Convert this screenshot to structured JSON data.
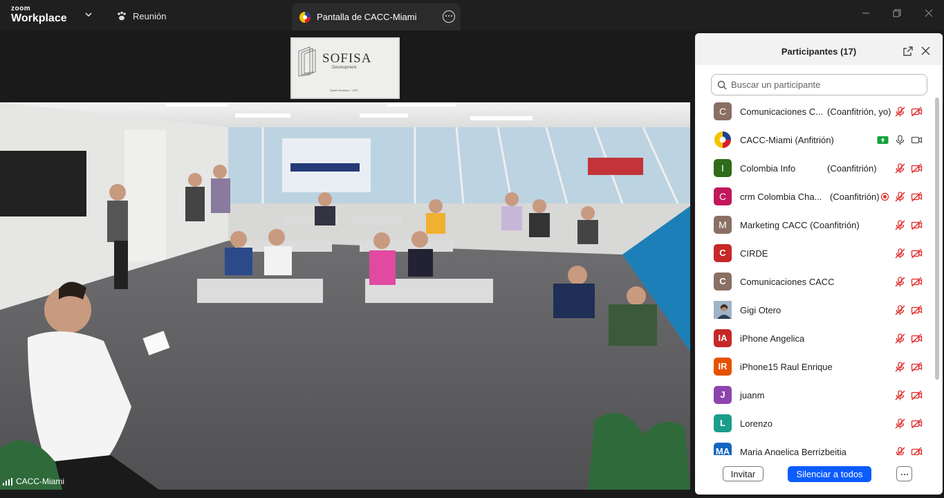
{
  "app": {
    "brand_top": "zoom",
    "brand_bottom": "Workplace"
  },
  "tabs": {
    "meeting_label": "Reunión",
    "share_label": "Pantalla de CACC-Miami"
  },
  "slide": {
    "title": "SOFISA",
    "subtitle": "Development",
    "footer": "Daniel Restrepo · CEO"
  },
  "video": {
    "name_label": "CACC-Miami"
  },
  "panel": {
    "title": "Participantes (17)",
    "search_placeholder": "Buscar un participante",
    "participants": [
      {
        "initial": "C",
        "color": "#8a6f63",
        "name": "Comunicaciones C...",
        "role": "(Coanfitrión, yo)",
        "mic": "muted",
        "cam": "off"
      },
      {
        "initial": "",
        "color": "#ffffff",
        "name": "CACC-Miami (Anfitrión)",
        "role": "",
        "mic": "on",
        "cam": "on",
        "sharing": true,
        "logo": true
      },
      {
        "initial": "I",
        "color": "#2e6b1a",
        "name": "Colombia Info",
        "role": "(Coanfitrión)",
        "mic": "muted",
        "cam": "off"
      },
      {
        "initial": "C",
        "color": "#c2185b",
        "name": "crm Colombia Cha...",
        "role": "(Coanfitrión)",
        "mic": "muted",
        "cam": "off",
        "recording": true
      },
      {
        "initial": "M",
        "color": "#8a6f63",
        "name": "Marketing CACC (Coanfitrión)",
        "role": "",
        "mic": "muted",
        "cam": "off"
      },
      {
        "initial": "C",
        "color": "#c62828",
        "name": "CIRDE",
        "role": "",
        "mic": "muted",
        "cam": "off"
      },
      {
        "initial": "C",
        "color": "#8a6f63",
        "name": "Comunicaciones CACC",
        "role": "",
        "mic": "muted",
        "cam": "off"
      },
      {
        "initial": "",
        "color": "#9fb4c8",
        "name": "Gigi Otero",
        "role": "",
        "mic": "muted",
        "cam": "off",
        "photo": true
      },
      {
        "initial": "IA",
        "color": "#c62828",
        "name": "iPhone Angelica",
        "role": "",
        "mic": "muted",
        "cam": "off"
      },
      {
        "initial": "IR",
        "color": "#e65100",
        "name": "iPhone15 Raul Enrique",
        "role": "",
        "mic": "muted",
        "cam": "off"
      },
      {
        "initial": "J",
        "color": "#8e44ad",
        "name": "juanm",
        "role": "",
        "mic": "muted",
        "cam": "off"
      },
      {
        "initial": "L",
        "color": "#1a9e8a",
        "name": "Lorenzo",
        "role": "",
        "mic": "muted",
        "cam": "off"
      },
      {
        "initial": "MA",
        "color": "#1565c0",
        "name": "Maria Angelica Berrizbeitia",
        "role": "",
        "mic": "muted",
        "cam": "off"
      }
    ],
    "invite_label": "Invitar",
    "mute_all_label": "Silenciar a todos"
  },
  "colors": {
    "accent_blue": "#0b5cff",
    "muted_red": "#e02828",
    "share_green": "#12a33a"
  },
  "icons": [
    "chevron-down-icon",
    "paw-icon",
    "more-icon",
    "minimize-icon",
    "restore-icon",
    "close-icon",
    "popout-icon",
    "search-icon",
    "mic-muted-icon",
    "camera-off-icon",
    "mic-icon",
    "camera-icon",
    "share-screen-icon",
    "recording-icon",
    "signal-icon"
  ]
}
